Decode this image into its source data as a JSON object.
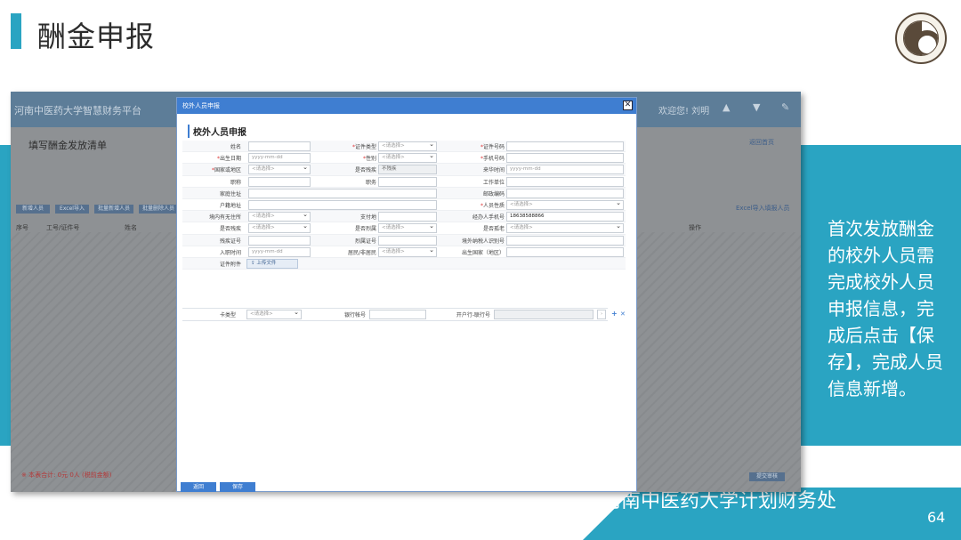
{
  "slide": {
    "title": "酬金申报",
    "side_text": "首次发放酬金的校外人员需完成校外人员申报信息，完成后点击【保存】，完成人员信息新增。",
    "footer": "河南中医药大学计划财务处",
    "page_number": "64"
  },
  "screenshot": {
    "app_title": "河南中医药大学智慧财务平台",
    "user": "欢迎您! 刘明",
    "sub_title": "填写酬金发放清单",
    "top_right_link": "返回首页",
    "right_link": "Excel导入填报人员",
    "buttons": [
      "新增人员",
      "Excel导入",
      "批量新增人员",
      "批量删除人员"
    ],
    "column_headers": [
      "序号",
      "工号/证件号",
      "姓名",
      "操作"
    ],
    "warning": "※ 本表合计: 0元 0人 (税前金额)",
    "right_button": "提交审核",
    "colors": {
      "accent": "#2aa4c2",
      "dialog_blue": "#3f7ed1",
      "dim": "#8e9194"
    }
  },
  "dialog": {
    "titlebar": "校外人员申报",
    "heading": "校外人员申报",
    "close_icon": "close-icon",
    "rows": [
      [
        {
          "label": "姓名",
          "req": false,
          "type": "text",
          "value": ""
        },
        {
          "label": "证件类型",
          "req": true,
          "type": "select",
          "value": "<请选择>"
        },
        {
          "label": "证件号码",
          "req": true,
          "type": "text",
          "value": ""
        }
      ],
      [
        {
          "label": "出生日期",
          "req": true,
          "type": "date",
          "value": "yyyy-mm-dd"
        },
        {
          "label": "性别",
          "req": true,
          "type": "select",
          "value": "<请选择>"
        },
        {
          "label": "手机号码",
          "req": true,
          "type": "text",
          "value": ""
        }
      ],
      [
        {
          "label": "国家或地区",
          "req": true,
          "type": "select",
          "value": "<请选择>"
        },
        {
          "label": "是否残疾",
          "req": false,
          "type": "readonly",
          "value": "不残疾"
        },
        {
          "label": "来华时间",
          "req": false,
          "type": "date",
          "value": "yyyy-mm-dd"
        }
      ],
      [
        {
          "label": "职称",
          "req": false,
          "type": "text",
          "value": ""
        },
        {
          "label": "职务",
          "req": false,
          "type": "text",
          "value": ""
        },
        {
          "label": "工作单位",
          "req": false,
          "type": "text",
          "value": ""
        }
      ],
      [
        {
          "label": "家庭住址",
          "req": false,
          "type": "wide",
          "value": ""
        },
        {
          "label": "邮政编码",
          "req": false,
          "type": "text",
          "value": ""
        }
      ],
      [
        {
          "label": "户籍地址",
          "req": false,
          "type": "wide",
          "value": ""
        },
        {
          "label": "人员性质",
          "req": true,
          "type": "select",
          "value": "<请选择>"
        }
      ],
      [
        {
          "label": "境内有无住所",
          "req": false,
          "type": "select",
          "value": "<请选择>"
        },
        {
          "label": "支付地",
          "req": false,
          "type": "text",
          "value": ""
        },
        {
          "label": "经办人手机号",
          "req": false,
          "type": "text",
          "value": "18638588866"
        }
      ],
      [
        {
          "label": "是否残疾",
          "req": false,
          "type": "select",
          "value": "<请选择>"
        },
        {
          "label": "是否烈属",
          "req": false,
          "type": "select",
          "value": "<请选择>"
        },
        {
          "label": "是否孤老",
          "req": false,
          "type": "select",
          "value": "<请选择>"
        }
      ],
      [
        {
          "label": "残疾证号",
          "req": false,
          "type": "text",
          "value": ""
        },
        {
          "label": "烈属证号",
          "req": false,
          "type": "text",
          "value": ""
        },
        {
          "label": "境外纳税人识别号",
          "req": false,
          "type": "text",
          "value": ""
        }
      ],
      [
        {
          "label": "入职时间",
          "req": false,
          "type": "date",
          "value": "yyyy-mm-dd"
        },
        {
          "label": "居民/非居民",
          "req": false,
          "type": "select",
          "value": "<请选择>"
        },
        {
          "label": "出生国家（地区）",
          "req": false,
          "type": "text",
          "value": ""
        }
      ]
    ],
    "attachment_label": "证件附件",
    "upload_label": "上传文件",
    "bank": {
      "card_type_label": "卡类型",
      "card_type_value": "<请选择>",
      "account_label": "银行帐号",
      "branch_label": "开户行-联行号",
      "add_icon": "+",
      "remove_icon": "✕"
    },
    "buttons": {
      "back": "返回",
      "save": "保存"
    }
  }
}
